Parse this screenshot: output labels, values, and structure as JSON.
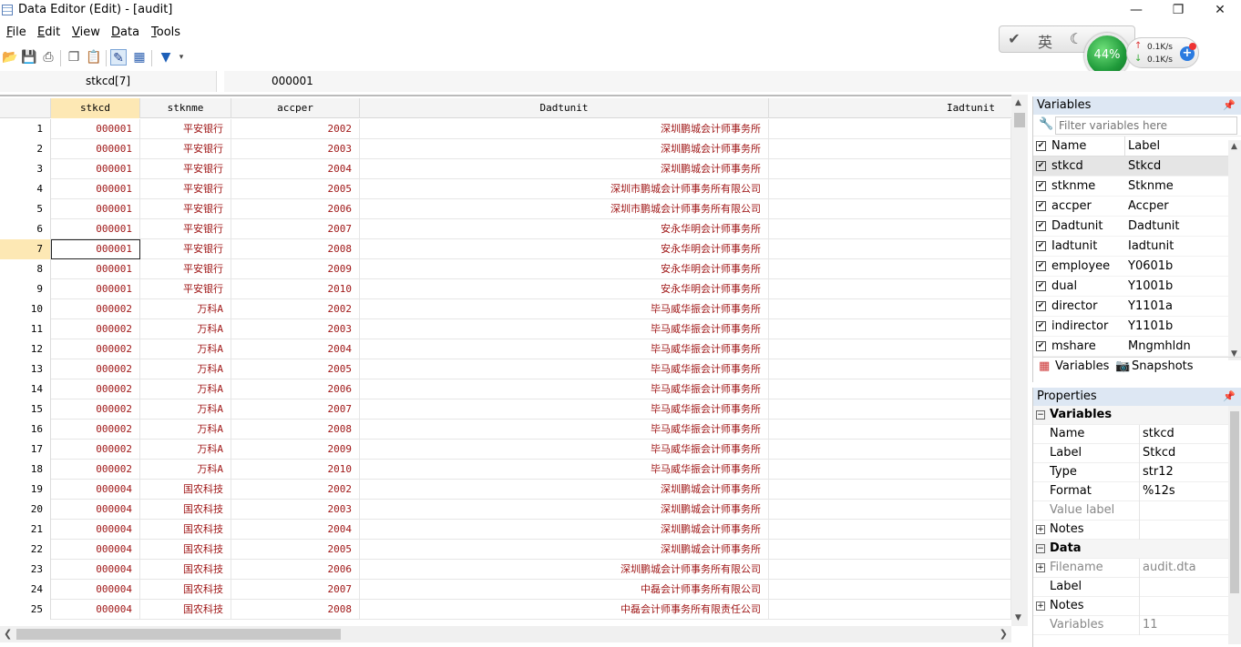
{
  "window": {
    "title": "Data Editor (Edit) - [audit]",
    "minimize": "—",
    "maximize": "❐",
    "close": "✕"
  },
  "menu": [
    "File",
    "Edit",
    "View",
    "Data",
    "Tools"
  ],
  "menu_underline": [
    "F",
    "E",
    "V",
    "D",
    "T"
  ],
  "menu_rest": [
    "ile",
    "dit",
    "iew",
    "ata",
    "ools"
  ],
  "sysmon": {
    "percent": "44%",
    "upload": "0.1K/s",
    "download": "0.1K/s",
    "ime": "英"
  },
  "cell": {
    "name": "stkcd[7]",
    "value": "000001"
  },
  "grid": {
    "columns": [
      "stkcd",
      "stknme",
      "accper",
      "Dadtunit",
      "Iadtunit"
    ],
    "selected_row": 7,
    "rows": [
      [
        "1",
        "000001",
        "平安银行",
        "2002",
        "深圳鹏城会计师事务所"
      ],
      [
        "2",
        "000001",
        "平安银行",
        "2003",
        "深圳鹏城会计师事务所"
      ],
      [
        "3",
        "000001",
        "平安银行",
        "2004",
        "深圳鹏城会计师事务所"
      ],
      [
        "4",
        "000001",
        "平安银行",
        "2005",
        "深圳市鹏城会计师事务所有限公司"
      ],
      [
        "5",
        "000001",
        "平安银行",
        "2006",
        "深圳市鹏城会计师事务所有限公司"
      ],
      [
        "6",
        "000001",
        "平安银行",
        "2007",
        "安永华明会计师事务所"
      ],
      [
        "7",
        "000001",
        "平安银行",
        "2008",
        "安永华明会计师事务所"
      ],
      [
        "8",
        "000001",
        "平安银行",
        "2009",
        "安永华明会计师事务所"
      ],
      [
        "9",
        "000001",
        "平安银行",
        "2010",
        "安永华明会计师事务所"
      ],
      [
        "10",
        "000002",
        "万科A",
        "2002",
        "毕马威华振会计师事务所"
      ],
      [
        "11",
        "000002",
        "万科A",
        "2003",
        "毕马威华振会计师事务所"
      ],
      [
        "12",
        "000002",
        "万科A",
        "2004",
        "毕马威华振会计师事务所"
      ],
      [
        "13",
        "000002",
        "万科A",
        "2005",
        "毕马威华振会计师事务所"
      ],
      [
        "14",
        "000002",
        "万科A",
        "2006",
        "毕马威华振会计师事务所"
      ],
      [
        "15",
        "000002",
        "万科A",
        "2007",
        "毕马威华振会计师事务所"
      ],
      [
        "16",
        "000002",
        "万科A",
        "2008",
        "毕马威华振会计师事务所"
      ],
      [
        "17",
        "000002",
        "万科A",
        "2009",
        "毕马威华振会计师事务所"
      ],
      [
        "18",
        "000002",
        "万科A",
        "2010",
        "毕马威华振会计师事务所"
      ],
      [
        "19",
        "000004",
        "国农科技",
        "2002",
        "深圳鹏城会计师事务所"
      ],
      [
        "20",
        "000004",
        "国农科技",
        "2003",
        "深圳鹏城会计师事务所"
      ],
      [
        "21",
        "000004",
        "国农科技",
        "2004",
        "深圳鹏城会计师事务所"
      ],
      [
        "22",
        "000004",
        "国农科技",
        "2005",
        "深圳鹏城会计师事务所"
      ],
      [
        "23",
        "000004",
        "国农科技",
        "2006",
        "深圳鹏城会计师事务所有限公司"
      ],
      [
        "24",
        "000004",
        "国农科技",
        "2007",
        "中磊会计师事务所有限公司"
      ],
      [
        "25",
        "000004",
        "国农科技",
        "2008",
        "中磊会计师事务所有限责任公司"
      ]
    ]
  },
  "variables_panel": {
    "title": "Variables",
    "filter_placeholder": "Filter variables here",
    "header": {
      "name": "Name",
      "label": "Label"
    },
    "items": [
      {
        "name": "stkcd",
        "label": "Stkcd"
      },
      {
        "name": "stknme",
        "label": "Stknme"
      },
      {
        "name": "accper",
        "label": "Accper"
      },
      {
        "name": "Dadtunit",
        "label": "Dadtunit"
      },
      {
        "name": "Iadtunit",
        "label": "Iadtunit"
      },
      {
        "name": "employee",
        "label": "Y0601b"
      },
      {
        "name": "dual",
        "label": "Y1001b"
      },
      {
        "name": "director",
        "label": "Y1101a"
      },
      {
        "name": "indirector",
        "label": "Y1101b"
      },
      {
        "name": "mshare",
        "label": "Mngmhldn"
      }
    ],
    "tabs": [
      "Variables",
      "Snapshots"
    ]
  },
  "properties_panel": {
    "title": "Properties",
    "variables_group": "Variables",
    "var_props": [
      {
        "key": "Name",
        "value": "stkcd"
      },
      {
        "key": "Label",
        "value": "Stkcd"
      },
      {
        "key": "Type",
        "value": "str12"
      },
      {
        "key": "Format",
        "value": "%12s"
      },
      {
        "key": "Value label",
        "value": ""
      },
      {
        "key": "Notes",
        "value": ""
      }
    ],
    "data_group": "Data",
    "data_props": [
      {
        "key": "Filename",
        "value": "audit.dta"
      },
      {
        "key": "Label",
        "value": ""
      },
      {
        "key": "Notes",
        "value": ""
      },
      {
        "key": "Variables",
        "value": "11"
      }
    ]
  }
}
